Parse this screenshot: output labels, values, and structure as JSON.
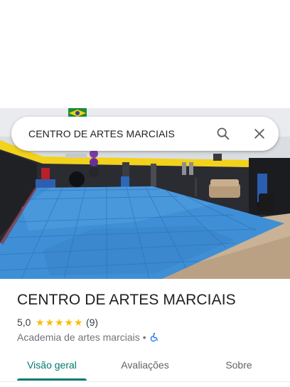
{
  "search": {
    "query": "CENTRO DE ARTES MARCIAIS"
  },
  "place": {
    "name": "CENTRO DE ARTES MARCIAIS",
    "rating": "5,0",
    "stars": 5,
    "review_count": "(9)",
    "category": "Academia de artes marciais",
    "separator": "•"
  },
  "tabs": [
    {
      "label": "Visão geral",
      "active": true
    },
    {
      "label": "Avaliações",
      "active": false
    },
    {
      "label": "Sobre",
      "active": false
    }
  ],
  "icons": {
    "search": "search-icon",
    "close": "close-icon",
    "accessibility": "wheelchair-icon",
    "star": "★"
  },
  "colors": {
    "accent": "#00796b",
    "star": "#fbbc04",
    "mat_blue": "#3f8fd6",
    "wall_yellow": "#f2d21a"
  }
}
